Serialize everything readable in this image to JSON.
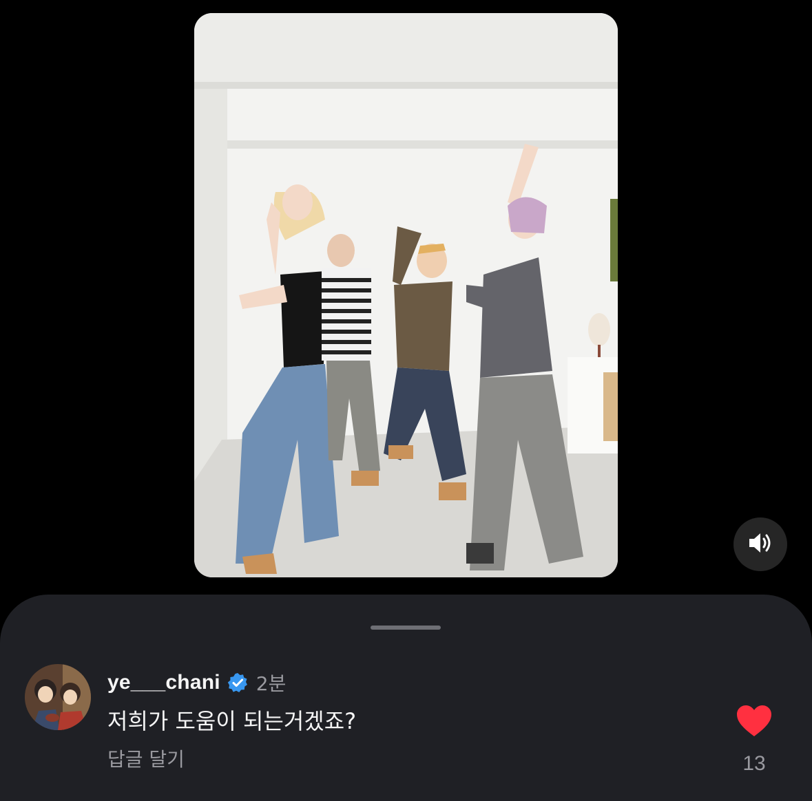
{
  "video": {
    "content_icon": "dance-video-thumbnail",
    "sound_icon": "speaker-icon"
  },
  "sheet": {
    "comment": {
      "avatar_icon": "profile-avatar",
      "username": "ye___chani",
      "verified_icon": "verified-badge-icon",
      "time_ago": "2분",
      "text": "저희가 도움이 되는거겠죠?",
      "reply_label": "답글 달기",
      "liked": true,
      "like_count": "13"
    }
  },
  "colors": {
    "background": "#000000",
    "sheet": "#1f2025",
    "text_primary": "#f5f5f5",
    "text_secondary": "#9a9aa0",
    "verified_blue": "#3897f0",
    "like_red": "#ff3040"
  }
}
